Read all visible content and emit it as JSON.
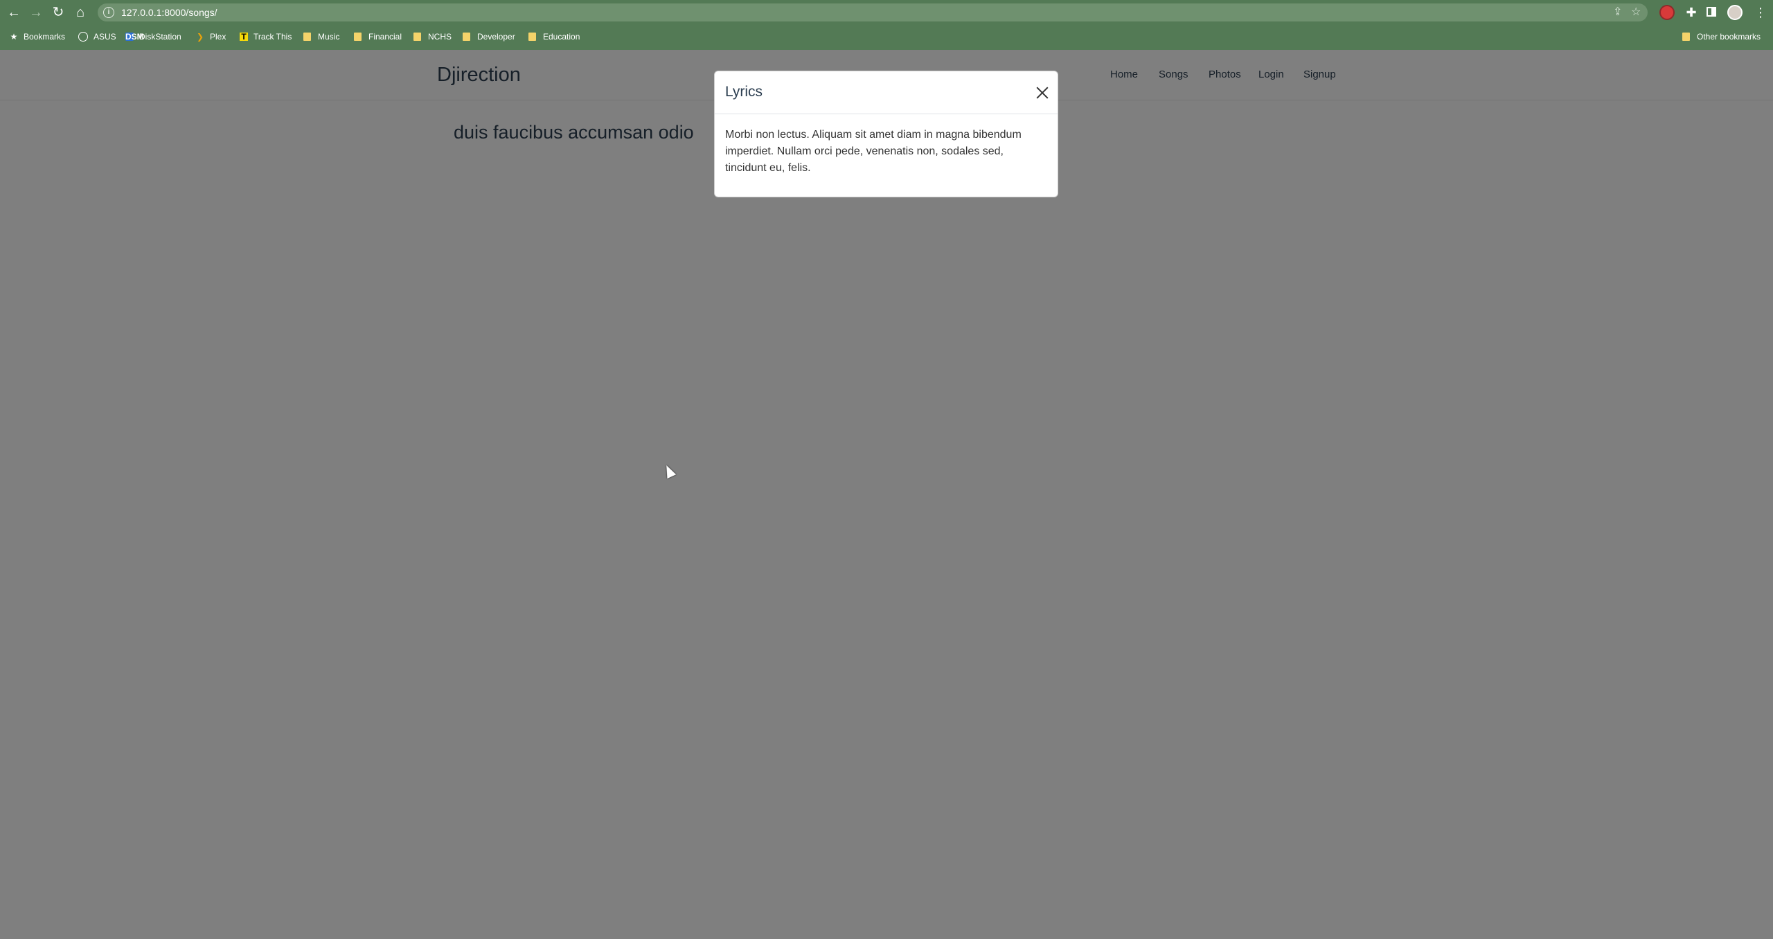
{
  "browser": {
    "url": "127.0.0.1:8000/songs/",
    "bookmarks": [
      {
        "label": "Bookmarks",
        "icon": "star-icon"
      },
      {
        "label": "ASUS",
        "icon": "asus-icon"
      },
      {
        "label": "DiskStation",
        "icon": "diskstation-icon"
      },
      {
        "label": "Plex",
        "icon": "plex-icon"
      },
      {
        "label": "Track This",
        "icon": "track-this-icon"
      },
      {
        "label": "Music",
        "icon": "folder-icon"
      },
      {
        "label": "Financial",
        "icon": "folder-icon"
      },
      {
        "label": "NCHS",
        "icon": "folder-icon"
      },
      {
        "label": "Developer",
        "icon": "folder-icon"
      },
      {
        "label": "Education",
        "icon": "folder-icon"
      }
    ],
    "other_bookmarks": "Other bookmarks",
    "chrome_color": "#537a55"
  },
  "site": {
    "brand": "Djirection",
    "nav": [
      "Home",
      "Songs",
      "Photos",
      "Login",
      "Signup"
    ]
  },
  "main": {
    "song_title": "duis faucibus accumsan odio"
  },
  "modal": {
    "title": "Lyrics",
    "body": "Morbi non lectus. Aliquam sit amet diam in magna bibendum imperdiet. Nullam orci pede, venenatis non, sodales sed, tincidunt eu, felis."
  }
}
